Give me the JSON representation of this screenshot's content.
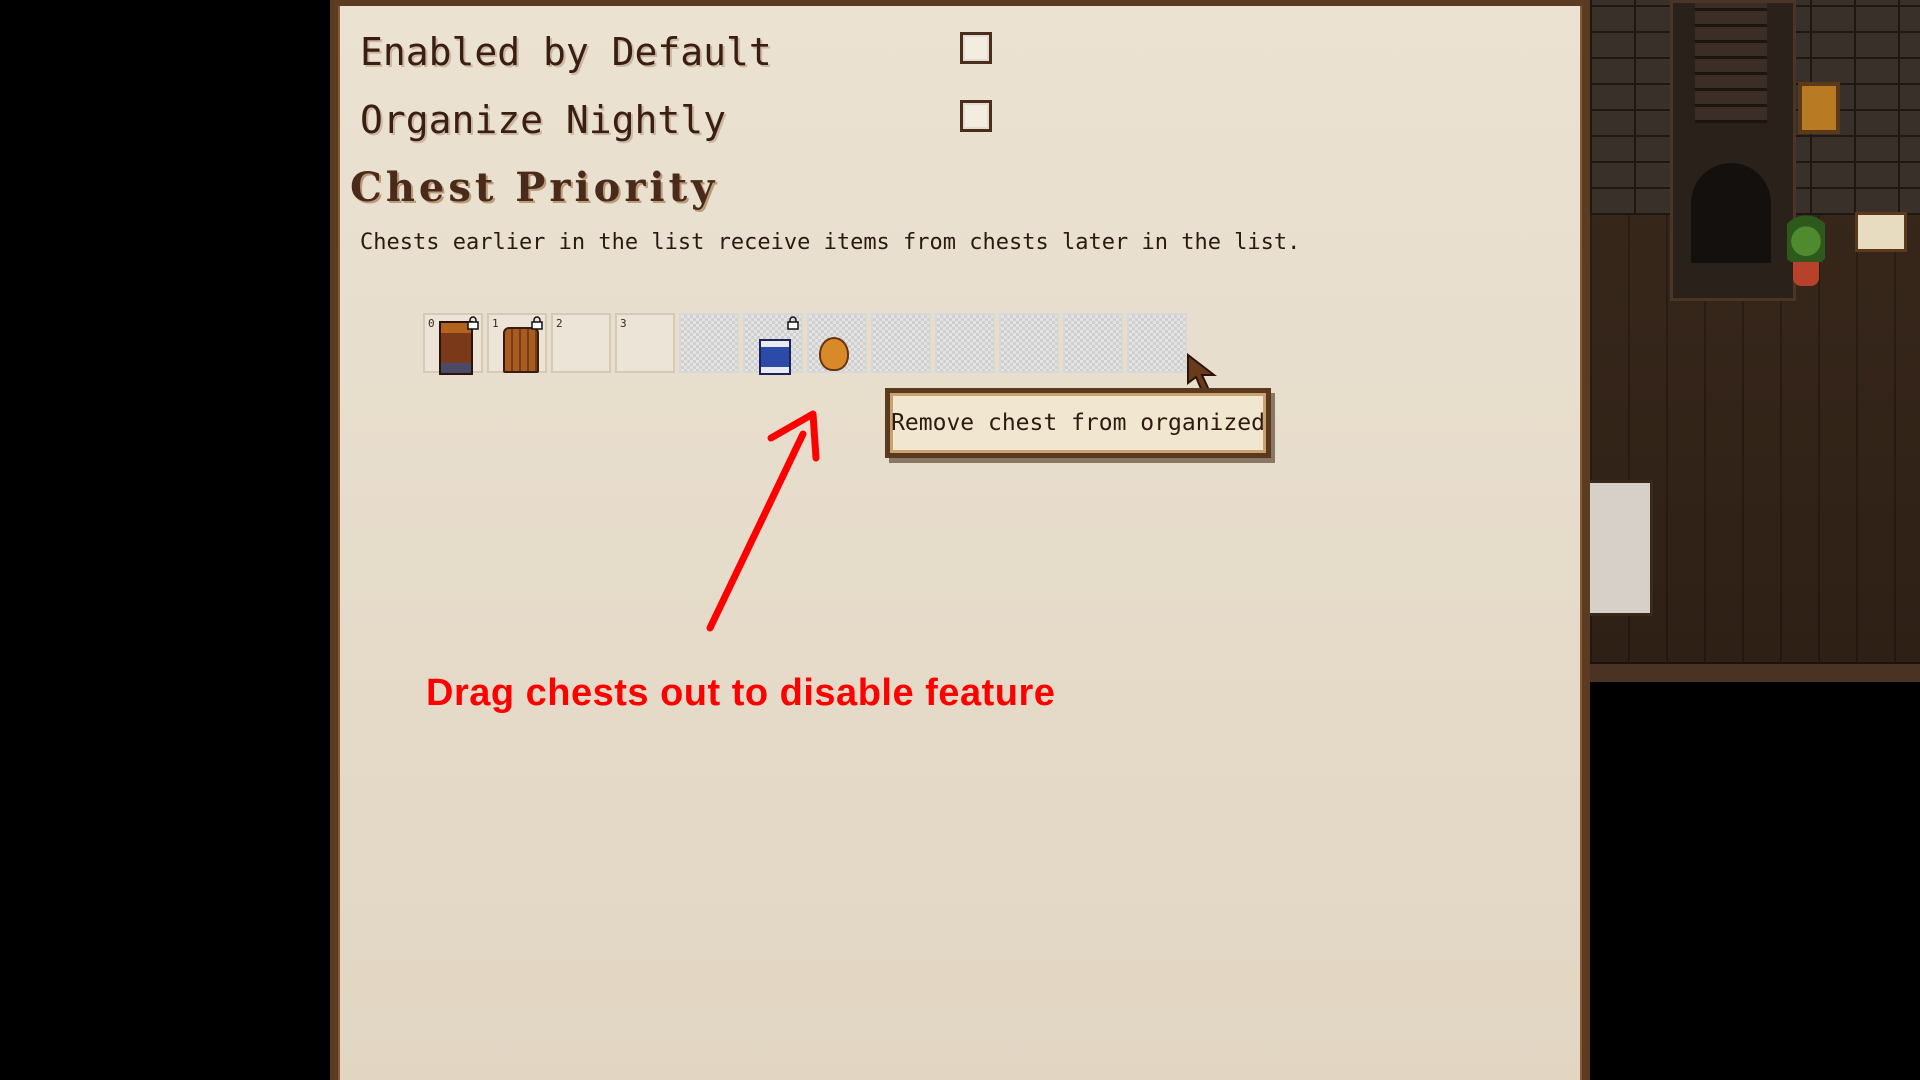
{
  "options": [
    {
      "label": "Enabled by Default",
      "checked": false
    },
    {
      "label": "Organize Nightly",
      "checked": false
    }
  ],
  "section": {
    "title": "Chest Priority",
    "description": "Chests earlier in the list receive items from chests later in the list."
  },
  "slots": [
    {
      "number": "0",
      "item": "tall-chest-icon",
      "locked": true
    },
    {
      "number": "1",
      "item": "wooden-chest-icon",
      "locked": true
    },
    {
      "number": "2",
      "item": "",
      "locked": false
    },
    {
      "number": "3",
      "item": "",
      "locked": false
    },
    {
      "number": "",
      "item": "",
      "locked": false
    },
    {
      "number": "",
      "item": "blue-chest-icon",
      "locked": true
    },
    {
      "number": "",
      "item": "acorn-chest-icon",
      "locked": false
    },
    {
      "number": "",
      "item": "",
      "locked": false
    },
    {
      "number": "",
      "item": "",
      "locked": false
    },
    {
      "number": "",
      "item": "",
      "locked": false
    },
    {
      "number": "",
      "item": "",
      "locked": false
    },
    {
      "number": "",
      "item": "",
      "locked": false
    }
  ],
  "tooltip": {
    "text": "Remove chest from organized"
  },
  "annotation": {
    "text": "Drag chests out to disable feature",
    "color": "#ff0000"
  },
  "colors": {
    "panel_border": "#5b3c22",
    "panel_bg": "#ebe2d2",
    "text_dark": "#3a1e12"
  }
}
